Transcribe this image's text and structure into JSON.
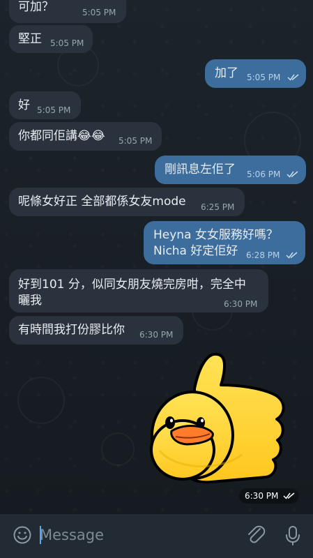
{
  "messages": [
    {
      "text": "可加？",
      "time": "5:05 PM"
    },
    {
      "text": "堅正",
      "time": "5:05 PM"
    },
    {
      "text": "加了",
      "time": "5:05 PM"
    },
    {
      "text": "好",
      "time": "5:05 PM"
    },
    {
      "text": "你都同佢講😂😂",
      "time": "5:05 PM"
    },
    {
      "text": "剛訊息左佢了",
      "time": "5:06 PM"
    },
    {
      "text": "呢條女好正 全部都係女友mode",
      "time": "6:25 PM"
    },
    {
      "text": "Heyna 女女服務好嗎？",
      "text_line2": "Nicha 好定佢好",
      "time": "6:28 PM"
    },
    {
      "text": "好到101 分，似同女朋友燒完房咁，完全中",
      "text_line2": "曬我",
      "time": "6:30 PM"
    },
    {
      "text": "有時間我打份膠比你",
      "time": "6:30 PM"
    }
  ],
  "sticker": {
    "icon": "duck-thumbs-up-sticker",
    "time": "6:30 PM"
  },
  "composer": {
    "placeholder": "Message",
    "emoji_icon": "emoji-icon",
    "attach_icon": "paperclip-icon",
    "mic_icon": "microphone-icon"
  },
  "colors": {
    "background": "#1a2026",
    "incoming_bubble": "#2a333d",
    "outgoing_bubble": "#3d6d9c",
    "accent": "#5ba7f1"
  }
}
